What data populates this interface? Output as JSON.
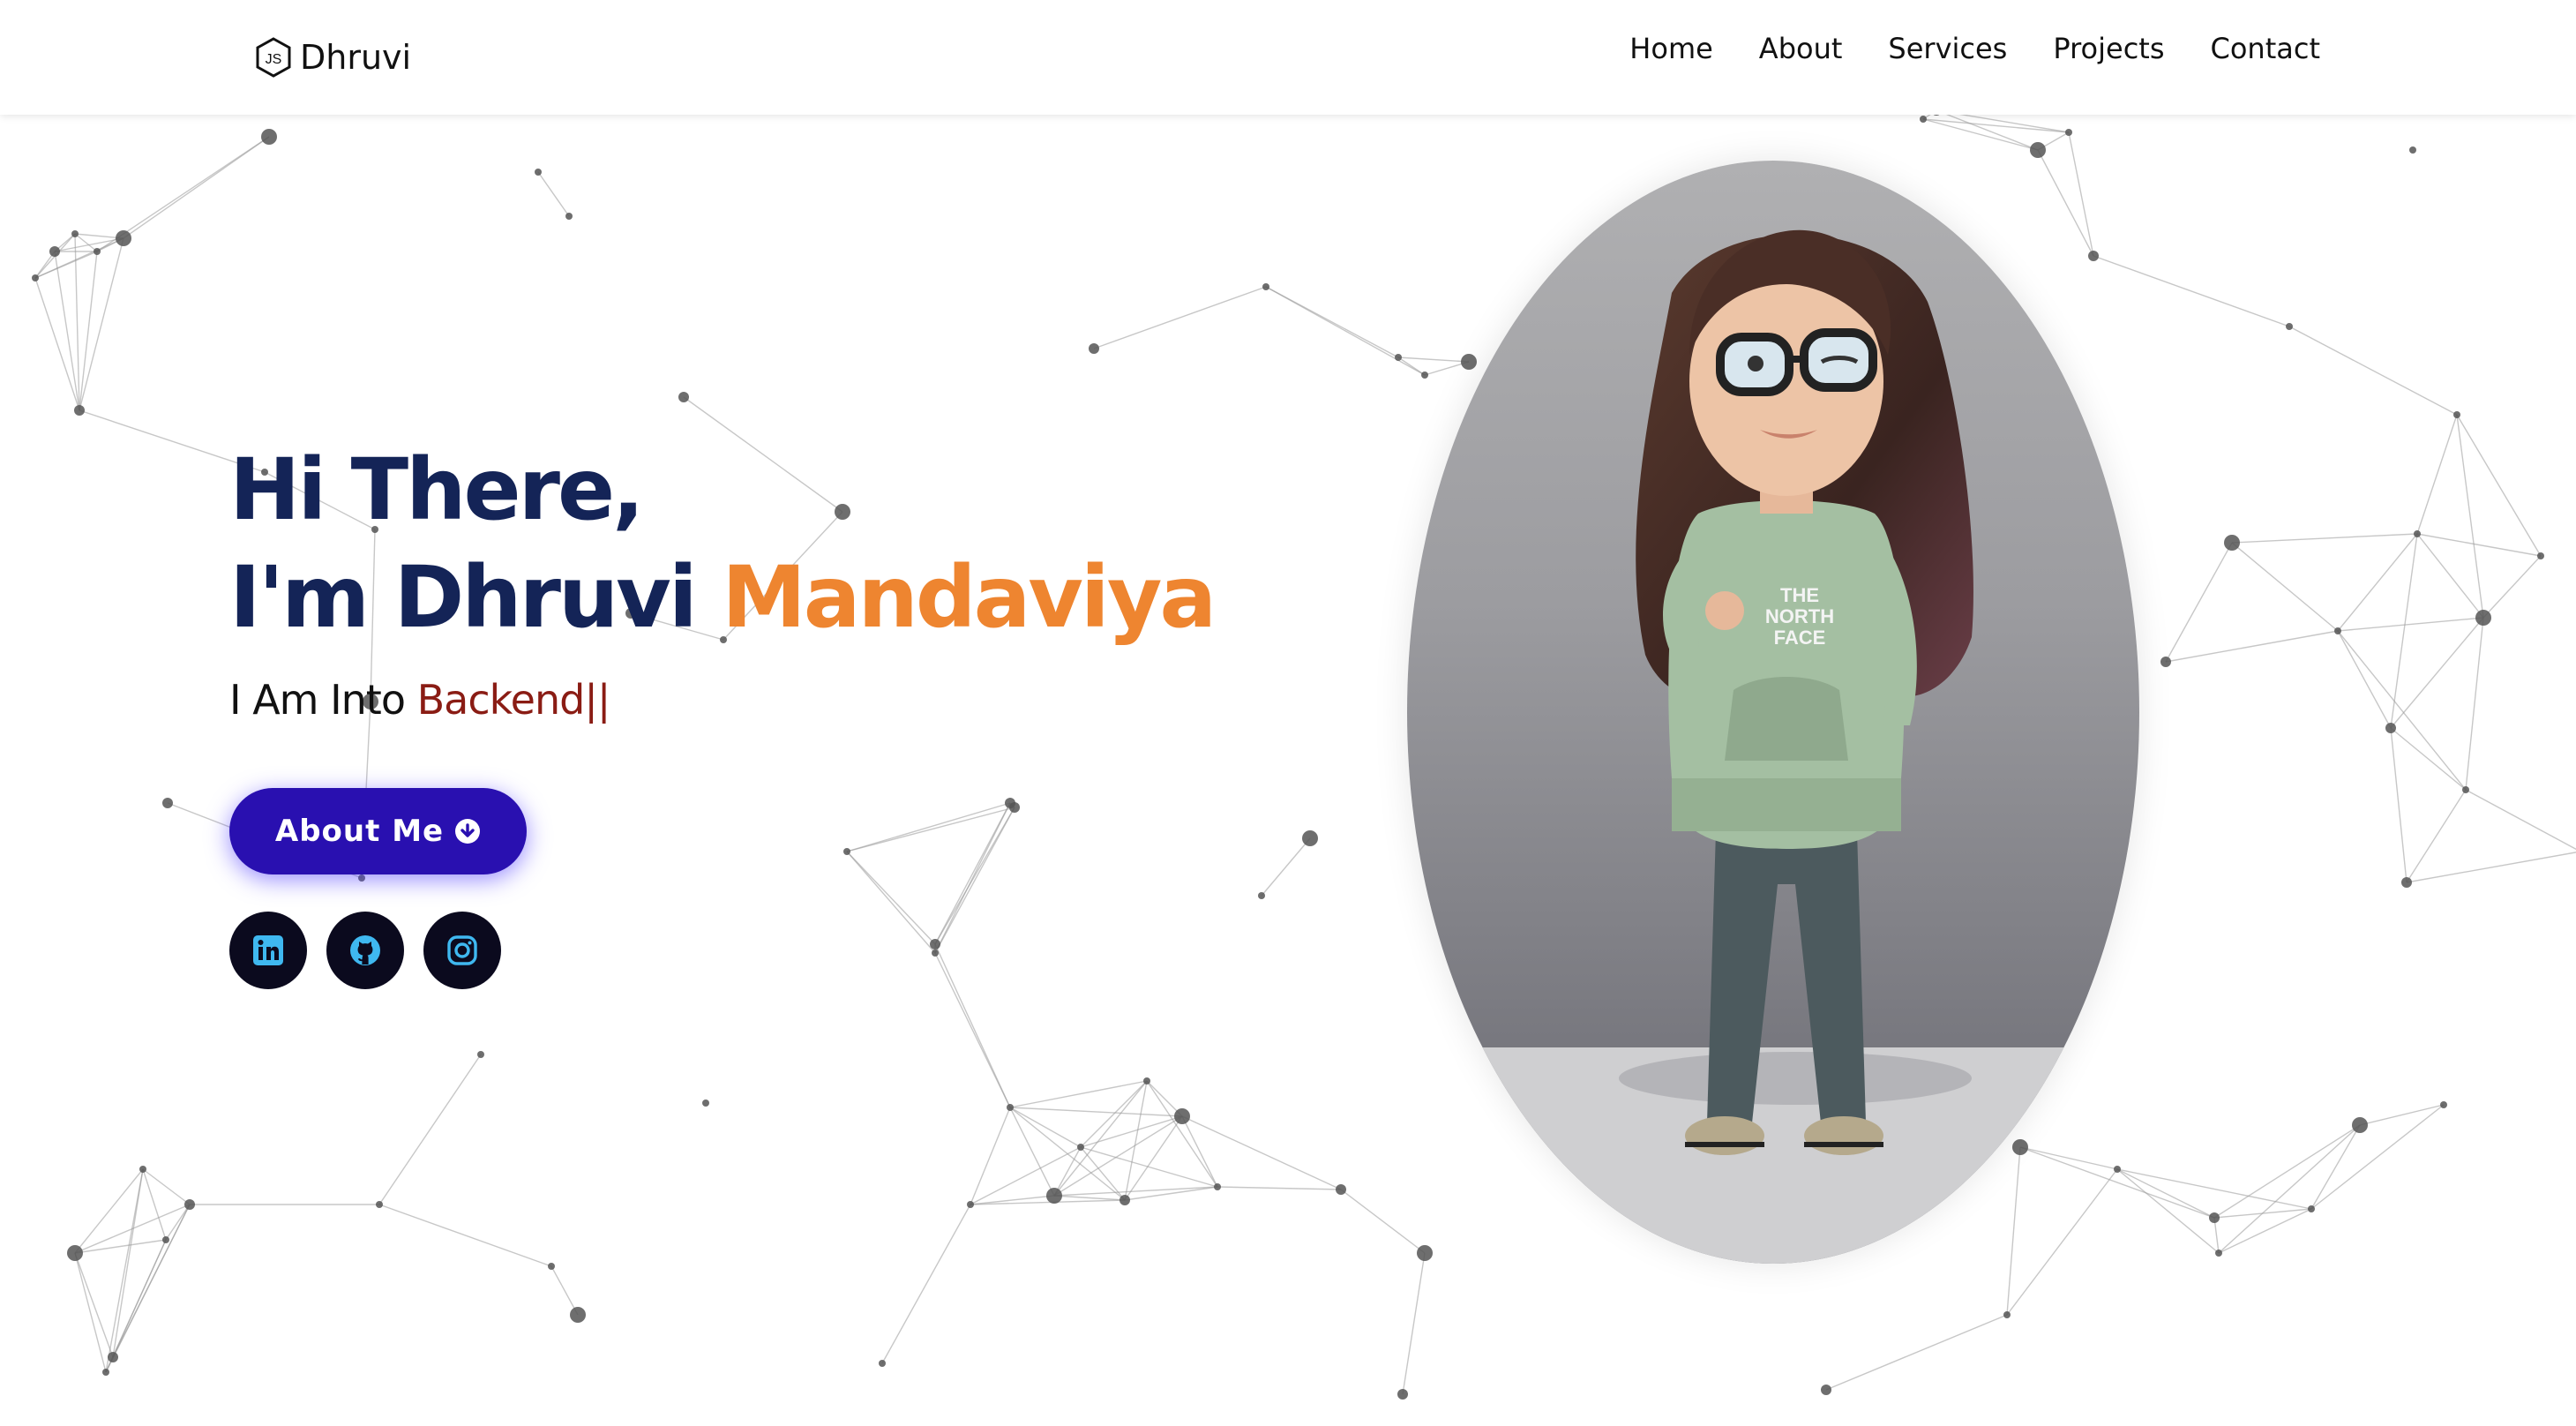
{
  "brand": {
    "name": "Dhruvi",
    "logo_icon": "js-hexagon-icon"
  },
  "nav": {
    "items": [
      {
        "label": "Home"
      },
      {
        "label": "About"
      },
      {
        "label": "Services"
      },
      {
        "label": "Projects"
      },
      {
        "label": "Contact"
      }
    ]
  },
  "hero": {
    "greeting": "Hi There,",
    "name_prefix": "I'm Dhruvi",
    "name_accent": "Mandaviya",
    "subtitle_prefix": "I Am Into",
    "typed_text": "Backend",
    "cursor": "||",
    "about_button": {
      "label": "About Me",
      "icon": "arrow-down-circle-icon"
    },
    "socials": [
      {
        "name": "linkedin",
        "icon": "linkedin-icon"
      },
      {
        "name": "github",
        "icon": "github-icon"
      },
      {
        "name": "instagram",
        "icon": "instagram-icon"
      }
    ]
  },
  "colors": {
    "heading": "#142457",
    "accent_name": "#ee8530",
    "typed": "#8a1c14",
    "button": "#2910b0",
    "social_bg": "#0b0a1e",
    "social_icon": "#3fb8f0"
  }
}
